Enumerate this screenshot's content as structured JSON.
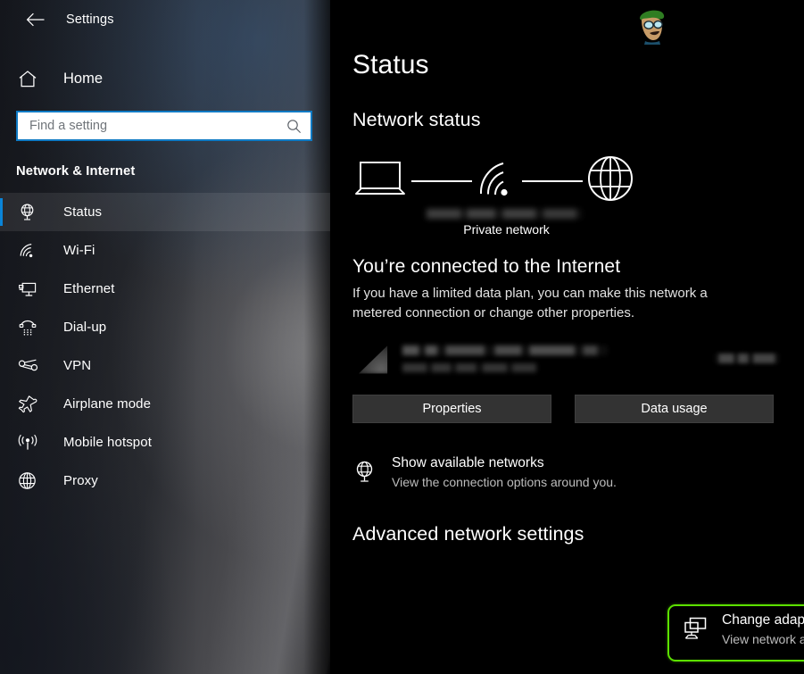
{
  "window": {
    "app_title": "Settings",
    "back_icon": "back-arrow-icon"
  },
  "sidebar": {
    "home": {
      "label": "Home",
      "icon": "home-icon"
    },
    "search": {
      "placeholder": "Find a setting",
      "value": "",
      "icon": "search-icon"
    },
    "section_title": "Network & Internet",
    "items": [
      {
        "label": "Status",
        "icon": "globe-monitor-icon",
        "selected": true
      },
      {
        "label": "Wi-Fi",
        "icon": "wifi-icon",
        "selected": false
      },
      {
        "label": "Ethernet",
        "icon": "ethernet-icon",
        "selected": false
      },
      {
        "label": "Dial-up",
        "icon": "dialup-phone-icon",
        "selected": false
      },
      {
        "label": "VPN",
        "icon": "vpn-key-icon",
        "selected": false
      },
      {
        "label": "Airplane mode",
        "icon": "airplane-icon",
        "selected": false
      },
      {
        "label": "Mobile hotspot",
        "icon": "hotspot-icon",
        "selected": false
      },
      {
        "label": "Proxy",
        "icon": "globe-icon",
        "selected": false
      }
    ]
  },
  "main": {
    "page_title": "Status",
    "network_status_heading": "Network status",
    "diagram": {
      "device_icon": "laptop-icon",
      "signal_icon": "wifi-signal-icon",
      "internet_icon": "globe-icon",
      "ssid": "",
      "network_type_label": "Private network"
    },
    "connection_headline": "You’re connected to the Internet",
    "connection_description": "If you have a limited data plan, you can make this network a metered connection or change other properties.",
    "network_usage_row": {
      "icon": "wifi-signal-icon",
      "name": "",
      "period": "",
      "size": ""
    },
    "buttons": {
      "properties": "Properties",
      "data_usage": "Data usage"
    },
    "show_networks": {
      "icon": "globe-monitor-icon",
      "title": "Show available networks",
      "description": "View the connection options around you."
    },
    "advanced_heading": "Advanced network settings",
    "change_adapter": {
      "icon": "network-adapters-icon",
      "title": "Change adapter options",
      "description": "View network adapters and change connection settings."
    },
    "watermark_icon": "mascot-avatar-icon"
  },
  "colors": {
    "accent_blue": "#0a84d8",
    "search_border": "#0e7ac4",
    "highlight_green": "#5ce000",
    "button_bg": "#333333",
    "background": "#000000"
  }
}
